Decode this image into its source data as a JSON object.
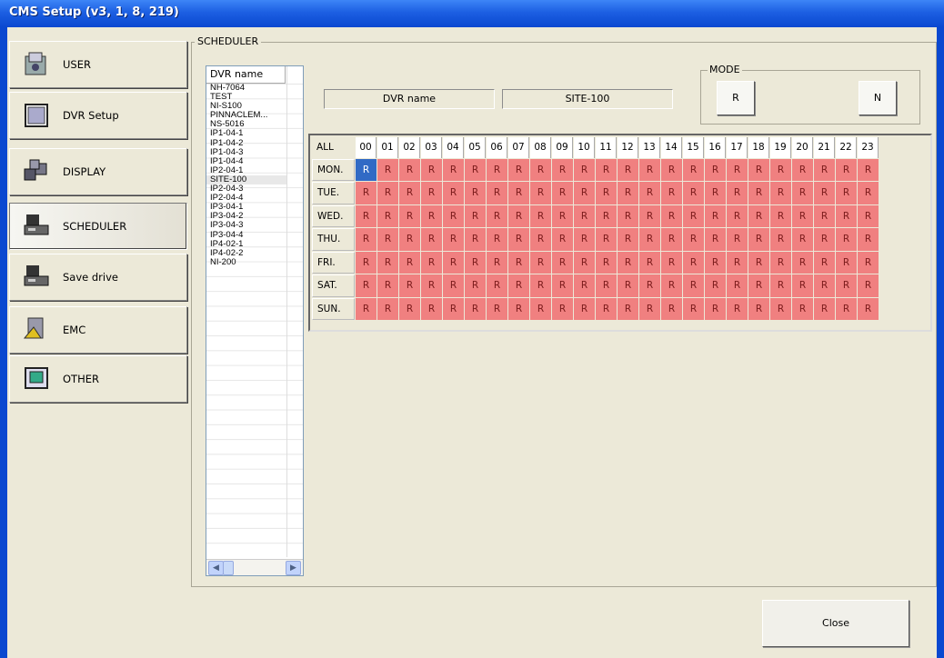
{
  "window": {
    "title": "CMS Setup (v3, 1, 8, 219)"
  },
  "nav": [
    {
      "label": "USER",
      "icon": "user-icon"
    },
    {
      "label": "DVR Setup",
      "icon": "dvr-setup-icon"
    },
    {
      "label": "DISPLAY",
      "icon": "display-icon"
    },
    {
      "label": "SCHEDULER",
      "icon": "scheduler-icon",
      "active": true
    },
    {
      "label": "Save drive",
      "icon": "save-drive-icon"
    },
    {
      "label": "EMC",
      "icon": "emc-icon"
    },
    {
      "label": "OTHER",
      "icon": "other-icon"
    }
  ],
  "scheduler": {
    "group_title": "SCHEDULER",
    "list_header": "DVR name",
    "dvr_list": [
      "NH-7064",
      "TEST",
      "NI-S100",
      "PINNACLEM...",
      "NS-5016",
      "IP1-04-1",
      "IP1-04-2",
      "IP1-04-3",
      "IP1-04-4",
      "IP2-04-1",
      "SITE-100",
      "IP2-04-3",
      "IP2-04-4",
      "IP3-04-1",
      "IP3-04-2",
      "IP3-04-3",
      "IP3-04-4",
      "IP4-02-1",
      "IP4-02-2",
      "NI-200"
    ],
    "selected_dvr": "SITE-100",
    "dvr_name_label": "DVR name",
    "dvr_name_value": "SITE-100",
    "mode": {
      "title": "MODE",
      "buttons": [
        "R",
        "N"
      ]
    },
    "grid": {
      "corner": "ALL",
      "hours": [
        "00",
        "01",
        "02",
        "03",
        "04",
        "05",
        "06",
        "07",
        "08",
        "09",
        "10",
        "11",
        "12",
        "13",
        "14",
        "15",
        "16",
        "17",
        "18",
        "19",
        "20",
        "21",
        "22",
        "23"
      ],
      "days": [
        "MON.",
        "TUE.",
        "WED.",
        "THU.",
        "FRI.",
        "SAT.",
        "SUN."
      ],
      "cell_value": "R",
      "selected_cell": {
        "day": "MON.",
        "hour": "00"
      },
      "colors": {
        "record": "#f08080",
        "selected": "#316ac5"
      }
    }
  },
  "close_label": "Close"
}
